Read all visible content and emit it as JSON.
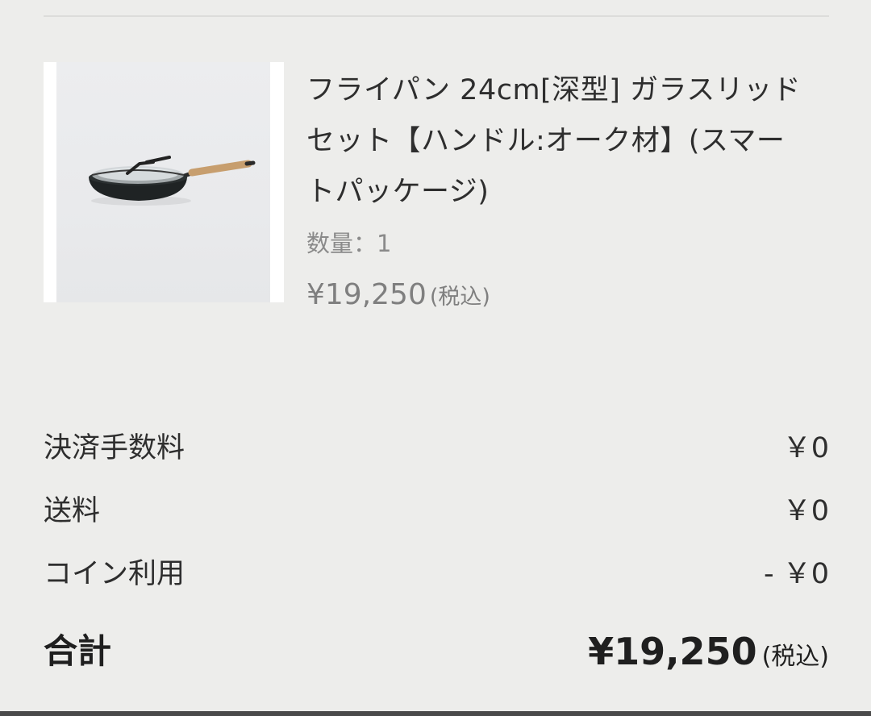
{
  "product": {
    "name": "フライパン 24cm[深型] ガラスリッドセット【ハンドル:オーク材】(スマートパッケージ)",
    "quantity_label": "数量：",
    "quantity_value": "1",
    "price": "¥19,250",
    "tax_note": "(税込)",
    "image_subject": "frying-pan-with-glass-lid"
  },
  "summary": {
    "rows": [
      {
        "label": "決済手数料",
        "value": "￥0"
      },
      {
        "label": "送料",
        "value": "￥0"
      },
      {
        "label": "コイン利用",
        "value": "- ￥0"
      }
    ]
  },
  "total": {
    "label": "合計",
    "amount": "¥19,250",
    "tax_note": "(税込)"
  }
}
